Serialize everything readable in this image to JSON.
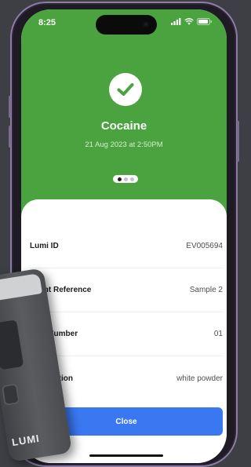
{
  "status_bar": {
    "time": "8:25"
  },
  "result": {
    "title": "Cocaine",
    "timestamp": "21 Aug 2023 at 2:50PM",
    "colors": {
      "positive_green": "#4aa33f"
    }
  },
  "pager": {
    "pages": 3,
    "current": 1
  },
  "details": [
    {
      "label": "Lumi ID",
      "value": "EV005694"
    },
    {
      "label": "Event Reference",
      "value": "Sample 2"
    },
    {
      "label": "Item Number",
      "value": "01"
    },
    {
      "label": "Description",
      "value": "white powder"
    }
  ],
  "close_button": {
    "label": "Close",
    "color": "#3a78f2"
  },
  "device": {
    "brand": "LUMI"
  }
}
